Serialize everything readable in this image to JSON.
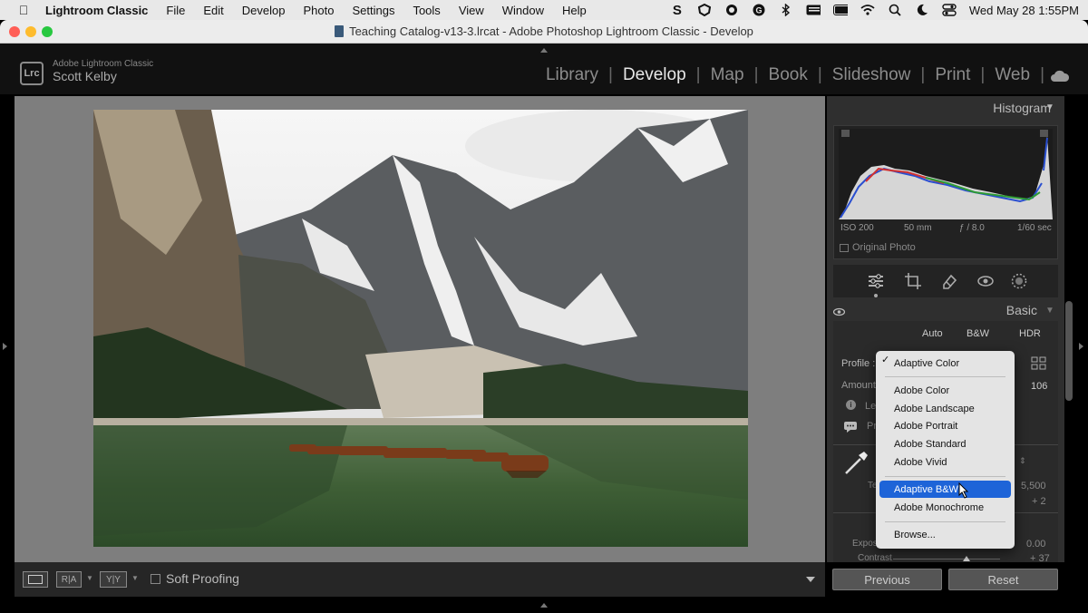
{
  "menubar": {
    "app": "Lightroom Classic",
    "items": [
      "File",
      "Edit",
      "Develop",
      "Photo",
      "Settings",
      "Tools",
      "View",
      "Window",
      "Help"
    ],
    "clock": "Wed May 28  1:55PM"
  },
  "window": {
    "title": "Teaching Catalog-v13-3.lrcat - Adobe Photoshop Lightroom Classic - Develop"
  },
  "identity": {
    "product": "Adobe Lightroom Classic",
    "user": "Scott Kelby",
    "badge": "Lrc"
  },
  "modules": [
    "Library",
    "Develop",
    "Map",
    "Book",
    "Slideshow",
    "Print",
    "Web"
  ],
  "active_module": "Develop",
  "toolbar": {
    "soft_proofing": "Soft Proofing",
    "btn_ra": "R|A",
    "btn_yy": "Y|Y"
  },
  "histogram": {
    "title": "Histogram",
    "iso": "ISO 200",
    "focal": "50 mm",
    "aperture": "ƒ / 8.0",
    "shutter": "1/60 sec",
    "original_photo": "Original Photo"
  },
  "basic": {
    "title": "Basic",
    "tabs": [
      "Auto",
      "B&W",
      "HDR"
    ],
    "profile_label": "Profile :",
    "amount_label": "Amount",
    "amount_value": "106",
    "temp_value": "5,500",
    "tint_value": "+ 2",
    "exposure_value": "0.00",
    "contrast_value": "+ 37"
  },
  "profile_menu": {
    "selected": "Adaptive Color",
    "items": [
      "Adobe Color",
      "Adobe Landscape",
      "Adobe Portrait",
      "Adobe Standard",
      "Adobe Vivid"
    ],
    "bw_items": [
      "Adaptive B&W",
      "Adobe Monochrome"
    ],
    "highlighted": "Adaptive B&W",
    "browse": "Browse..."
  },
  "footer": {
    "previous": "Previous",
    "reset": "Reset"
  },
  "colors": {
    "highlight": "#1e64d8",
    "panel": "#2f2f2f",
    "canvas": "#7e7e7e"
  }
}
